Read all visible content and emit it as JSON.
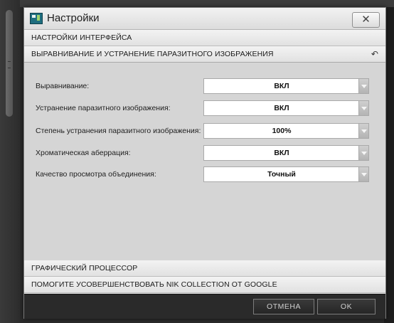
{
  "dialog": {
    "title": "Настройки",
    "close_label": "✕"
  },
  "sections": {
    "interface": "НАСТРОЙКИ ИНТЕРФЕЙСА",
    "alignment": "ВЫРАВНИВАНИЕ И УСТРАНЕНИЕ ПАРАЗИТНОГО ИЗОБРАЖЕНИЯ",
    "alignment_reset_icon": "↶",
    "gpu": "ГРАФИЧЕСКИЙ ПРОЦЕССОР",
    "help": "ПОМОГИТЕ УСОВЕРШЕНСТВОВАТЬ NIK COLLECTION ОТ GOOGLE"
  },
  "settings": [
    {
      "label": "Выравнивание:",
      "value": "ВКЛ"
    },
    {
      "label": "Устранение паразитного изображения:",
      "value": "ВКЛ"
    },
    {
      "label": "Степень устранения паразитного изображения:",
      "value": "100%"
    },
    {
      "label": "Хроматическая аберрация:",
      "value": "ВКЛ"
    },
    {
      "label": "Качество просмотра объединения:",
      "value": "Точный"
    }
  ],
  "footer": {
    "cancel_label": "ОТМЕНА",
    "ok_label": "OK"
  }
}
